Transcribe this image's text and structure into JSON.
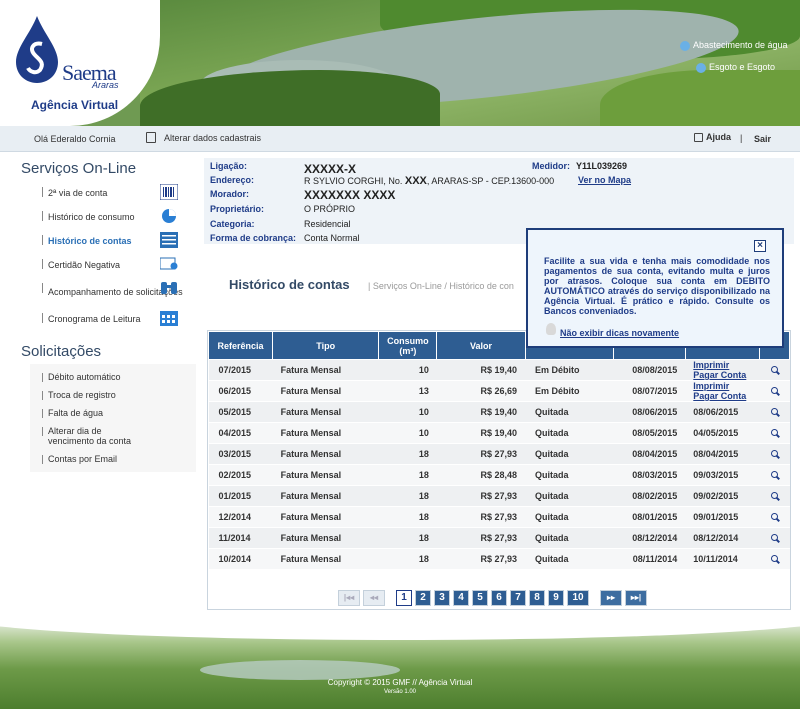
{
  "header": {
    "brand": "Saema",
    "brand_sub": "Araras",
    "agency": "Agência Virtual",
    "links": [
      "Abastecimento de água",
      "Esgoto e Esgoto"
    ]
  },
  "userbar": {
    "greeting": "Olá Ederaldo Cornia",
    "edit": "Alterar dados cadastrais",
    "help": "Ajuda",
    "sep": "|",
    "logout": "Sair"
  },
  "sidebar": {
    "title": "Serviços On-Line",
    "items": [
      {
        "label": "2ª via de conta"
      },
      {
        "label": "Histórico de consumo"
      },
      {
        "label": "Histórico de contas"
      },
      {
        "label": "Certidão Negativa"
      },
      {
        "label": "Acompanhamento de solicitações"
      },
      {
        "label": "Cronograma de Leitura"
      }
    ],
    "sol_title": "Solicitações",
    "sol_items": [
      {
        "label": "Débito automático"
      },
      {
        "label": "Troca de registro"
      },
      {
        "label": "Falta de água"
      },
      {
        "label": "Alterar dia de vencimento da conta"
      },
      {
        "label": "Contas por Email"
      }
    ]
  },
  "info": {
    "ligacao_label": "Ligação:",
    "ligacao": "XXXXX-X",
    "endereco_label": "Endereço:",
    "endereco": "R SYLVIO CORGHI, No.",
    "endereco_num": "XXX",
    "endereco_rest": ", ARARAS-SP - CEP.13600-000",
    "mapa": "Ver no Mapa",
    "medidor_label": "Medidor:",
    "medidor": "Y11L039269",
    "morador_label": "Morador:",
    "morador": "XXXXXXX XXXX",
    "proprietario_label": "Proprietário:",
    "proprietario": "O PRÓPRIO",
    "categoria_label": "Categoria:",
    "categoria": "Residencial",
    "cobranca_label": "Forma de cobrança:",
    "cobranca": "Conta Normal"
  },
  "page": {
    "title": "Histórico de contas",
    "crumb": "| Serviços On-Line / Histórico de con"
  },
  "tip": {
    "close": "×",
    "message": "Facilite a sua vida e tenha mais comodidade nos pagamentos de sua conta, evitando multa e juros por atrasos. Coloque sua conta em DEBITO AUTOMÁTICO através do serviço disponibilizado na Agência Virtual. É prático e rápido. Consulte os Bancos conveniados.",
    "noshow": "Não exibir dicas novamente"
  },
  "table": {
    "headers": {
      "ref": "Referência",
      "tipo": "Tipo",
      "consumo": "Consumo (m³)",
      "valor": "Valor"
    },
    "action_print": "Imprimir",
    "action_pay": "Pagar Conta",
    "rows": [
      {
        "ref": "07/2015",
        "tipo": "Fatura Mensal",
        "consumo": "10",
        "valor": "R$ 19,40",
        "situacao": "Em Débito",
        "venc": "08/08/2015",
        "pag": ""
      },
      {
        "ref": "06/2015",
        "tipo": "Fatura Mensal",
        "consumo": "13",
        "valor": "R$ 26,69",
        "situacao": "Em Débito",
        "venc": "08/07/2015",
        "pag": ""
      },
      {
        "ref": "05/2015",
        "tipo": "Fatura Mensal",
        "consumo": "10",
        "valor": "R$ 19,40",
        "situacao": "Quitada",
        "venc": "08/06/2015",
        "pag": "08/06/2015"
      },
      {
        "ref": "04/2015",
        "tipo": "Fatura Mensal",
        "consumo": "10",
        "valor": "R$ 19,40",
        "situacao": "Quitada",
        "venc": "08/05/2015",
        "pag": "04/05/2015"
      },
      {
        "ref": "03/2015",
        "tipo": "Fatura Mensal",
        "consumo": "18",
        "valor": "R$ 27,93",
        "situacao": "Quitada",
        "venc": "08/04/2015",
        "pag": "08/04/2015"
      },
      {
        "ref": "02/2015",
        "tipo": "Fatura Mensal",
        "consumo": "18",
        "valor": "R$ 28,48",
        "situacao": "Quitada",
        "venc": "08/03/2015",
        "pag": "09/03/2015"
      },
      {
        "ref": "01/2015",
        "tipo": "Fatura Mensal",
        "consumo": "18",
        "valor": "R$ 27,93",
        "situacao": "Quitada",
        "venc": "08/02/2015",
        "pag": "09/02/2015"
      },
      {
        "ref": "12/2014",
        "tipo": "Fatura Mensal",
        "consumo": "18",
        "valor": "R$ 27,93",
        "situacao": "Quitada",
        "venc": "08/01/2015",
        "pag": "09/01/2015"
      },
      {
        "ref": "11/2014",
        "tipo": "Fatura Mensal",
        "consumo": "18",
        "valor": "R$ 27,93",
        "situacao": "Quitada",
        "venc": "08/12/2014",
        "pag": "08/12/2014"
      },
      {
        "ref": "10/2014",
        "tipo": "Fatura Mensal",
        "consumo": "18",
        "valor": "R$ 27,93",
        "situacao": "Quitada",
        "venc": "08/11/2014",
        "pag": "10/11/2014"
      }
    ]
  },
  "pager": {
    "first": "|◂◂",
    "prev": "◂◂",
    "pages": [
      "1",
      "2",
      "3",
      "4",
      "5",
      "6",
      "7",
      "8",
      "9",
      "10"
    ],
    "current": "1",
    "next": "▸▸",
    "last": "▸▸|"
  },
  "footer": {
    "copyright": "Copyright © 2015 GMF // Agência Virtual",
    "version": "Versão 1.00"
  },
  "colors": {
    "primary": "#2e5d92",
    "brand": "#1f3c88",
    "accent": "#6f9a52"
  }
}
